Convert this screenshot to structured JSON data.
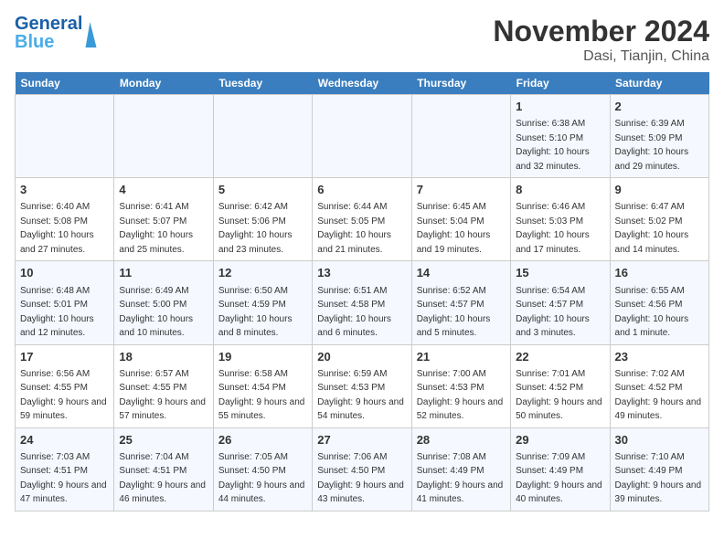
{
  "logo": {
    "line1": "General",
    "line2": "Blue"
  },
  "title": "November 2024",
  "subtitle": "Dasi, Tianjin, China",
  "weekdays": [
    "Sunday",
    "Monday",
    "Tuesday",
    "Wednesday",
    "Thursday",
    "Friday",
    "Saturday"
  ],
  "weeks": [
    [
      {
        "day": "",
        "info": ""
      },
      {
        "day": "",
        "info": ""
      },
      {
        "day": "",
        "info": ""
      },
      {
        "day": "",
        "info": ""
      },
      {
        "day": "",
        "info": ""
      },
      {
        "day": "1",
        "info": "Sunrise: 6:38 AM\nSunset: 5:10 PM\nDaylight: 10 hours and 32 minutes."
      },
      {
        "day": "2",
        "info": "Sunrise: 6:39 AM\nSunset: 5:09 PM\nDaylight: 10 hours and 29 minutes."
      }
    ],
    [
      {
        "day": "3",
        "info": "Sunrise: 6:40 AM\nSunset: 5:08 PM\nDaylight: 10 hours and 27 minutes."
      },
      {
        "day": "4",
        "info": "Sunrise: 6:41 AM\nSunset: 5:07 PM\nDaylight: 10 hours and 25 minutes."
      },
      {
        "day": "5",
        "info": "Sunrise: 6:42 AM\nSunset: 5:06 PM\nDaylight: 10 hours and 23 minutes."
      },
      {
        "day": "6",
        "info": "Sunrise: 6:44 AM\nSunset: 5:05 PM\nDaylight: 10 hours and 21 minutes."
      },
      {
        "day": "7",
        "info": "Sunrise: 6:45 AM\nSunset: 5:04 PM\nDaylight: 10 hours and 19 minutes."
      },
      {
        "day": "8",
        "info": "Sunrise: 6:46 AM\nSunset: 5:03 PM\nDaylight: 10 hours and 17 minutes."
      },
      {
        "day": "9",
        "info": "Sunrise: 6:47 AM\nSunset: 5:02 PM\nDaylight: 10 hours and 14 minutes."
      }
    ],
    [
      {
        "day": "10",
        "info": "Sunrise: 6:48 AM\nSunset: 5:01 PM\nDaylight: 10 hours and 12 minutes."
      },
      {
        "day": "11",
        "info": "Sunrise: 6:49 AM\nSunset: 5:00 PM\nDaylight: 10 hours and 10 minutes."
      },
      {
        "day": "12",
        "info": "Sunrise: 6:50 AM\nSunset: 4:59 PM\nDaylight: 10 hours and 8 minutes."
      },
      {
        "day": "13",
        "info": "Sunrise: 6:51 AM\nSunset: 4:58 PM\nDaylight: 10 hours and 6 minutes."
      },
      {
        "day": "14",
        "info": "Sunrise: 6:52 AM\nSunset: 4:57 PM\nDaylight: 10 hours and 5 minutes."
      },
      {
        "day": "15",
        "info": "Sunrise: 6:54 AM\nSunset: 4:57 PM\nDaylight: 10 hours and 3 minutes."
      },
      {
        "day": "16",
        "info": "Sunrise: 6:55 AM\nSunset: 4:56 PM\nDaylight: 10 hours and 1 minute."
      }
    ],
    [
      {
        "day": "17",
        "info": "Sunrise: 6:56 AM\nSunset: 4:55 PM\nDaylight: 9 hours and 59 minutes."
      },
      {
        "day": "18",
        "info": "Sunrise: 6:57 AM\nSunset: 4:55 PM\nDaylight: 9 hours and 57 minutes."
      },
      {
        "day": "19",
        "info": "Sunrise: 6:58 AM\nSunset: 4:54 PM\nDaylight: 9 hours and 55 minutes."
      },
      {
        "day": "20",
        "info": "Sunrise: 6:59 AM\nSunset: 4:53 PM\nDaylight: 9 hours and 54 minutes."
      },
      {
        "day": "21",
        "info": "Sunrise: 7:00 AM\nSunset: 4:53 PM\nDaylight: 9 hours and 52 minutes."
      },
      {
        "day": "22",
        "info": "Sunrise: 7:01 AM\nSunset: 4:52 PM\nDaylight: 9 hours and 50 minutes."
      },
      {
        "day": "23",
        "info": "Sunrise: 7:02 AM\nSunset: 4:52 PM\nDaylight: 9 hours and 49 minutes."
      }
    ],
    [
      {
        "day": "24",
        "info": "Sunrise: 7:03 AM\nSunset: 4:51 PM\nDaylight: 9 hours and 47 minutes."
      },
      {
        "day": "25",
        "info": "Sunrise: 7:04 AM\nSunset: 4:51 PM\nDaylight: 9 hours and 46 minutes."
      },
      {
        "day": "26",
        "info": "Sunrise: 7:05 AM\nSunset: 4:50 PM\nDaylight: 9 hours and 44 minutes."
      },
      {
        "day": "27",
        "info": "Sunrise: 7:06 AM\nSunset: 4:50 PM\nDaylight: 9 hours and 43 minutes."
      },
      {
        "day": "28",
        "info": "Sunrise: 7:08 AM\nSunset: 4:49 PM\nDaylight: 9 hours and 41 minutes."
      },
      {
        "day": "29",
        "info": "Sunrise: 7:09 AM\nSunset: 4:49 PM\nDaylight: 9 hours and 40 minutes."
      },
      {
        "day": "30",
        "info": "Sunrise: 7:10 AM\nSunset: 4:49 PM\nDaylight: 9 hours and 39 minutes."
      }
    ]
  ]
}
